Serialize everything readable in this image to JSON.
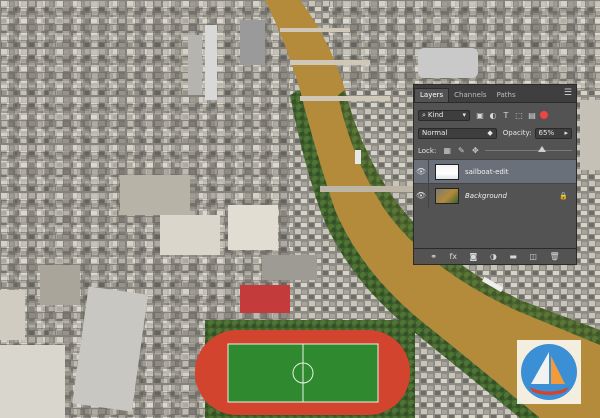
{
  "layers_panel": {
    "tabs": [
      "Layers",
      "Channels",
      "Paths"
    ],
    "filter_kind": "Kind",
    "blend_mode": "Normal",
    "opacity_label": "Opacity:",
    "opacity_value": "65%",
    "opacity_fraction": 0.65,
    "lock_label": "Lock:",
    "layers": [
      {
        "name": "sailboat-edit",
        "visible": true,
        "selected": true,
        "locked": false
      },
      {
        "name": "Background",
        "visible": true,
        "selected": false,
        "locked": true
      }
    ]
  },
  "icons": {
    "panel_menu": "panel-menu-icon",
    "filter_search": "search-icon",
    "filter_pixel": "image-filter-icon",
    "filter_adjust": "adjustment-filter-icon",
    "filter_type": "type-filter-icon",
    "filter_shape": "shape-filter-icon",
    "filter_smart": "smart-object-filter-icon",
    "lock_pixels": "lock-transparent-icon",
    "lock_image": "lock-image-icon",
    "lock_position": "lock-position-icon",
    "eye": "eye-icon",
    "bottom": [
      "link-icon",
      "fx-icon",
      "mask-icon",
      "adjustment-icon",
      "folder-icon",
      "new-layer-icon",
      "trash-icon"
    ]
  },
  "colors": {
    "panel_bg": "#535353",
    "selected_layer": "#69707a",
    "river": "#b48a3b",
    "track": "#d2442e",
    "field": "#2f8a2f"
  }
}
